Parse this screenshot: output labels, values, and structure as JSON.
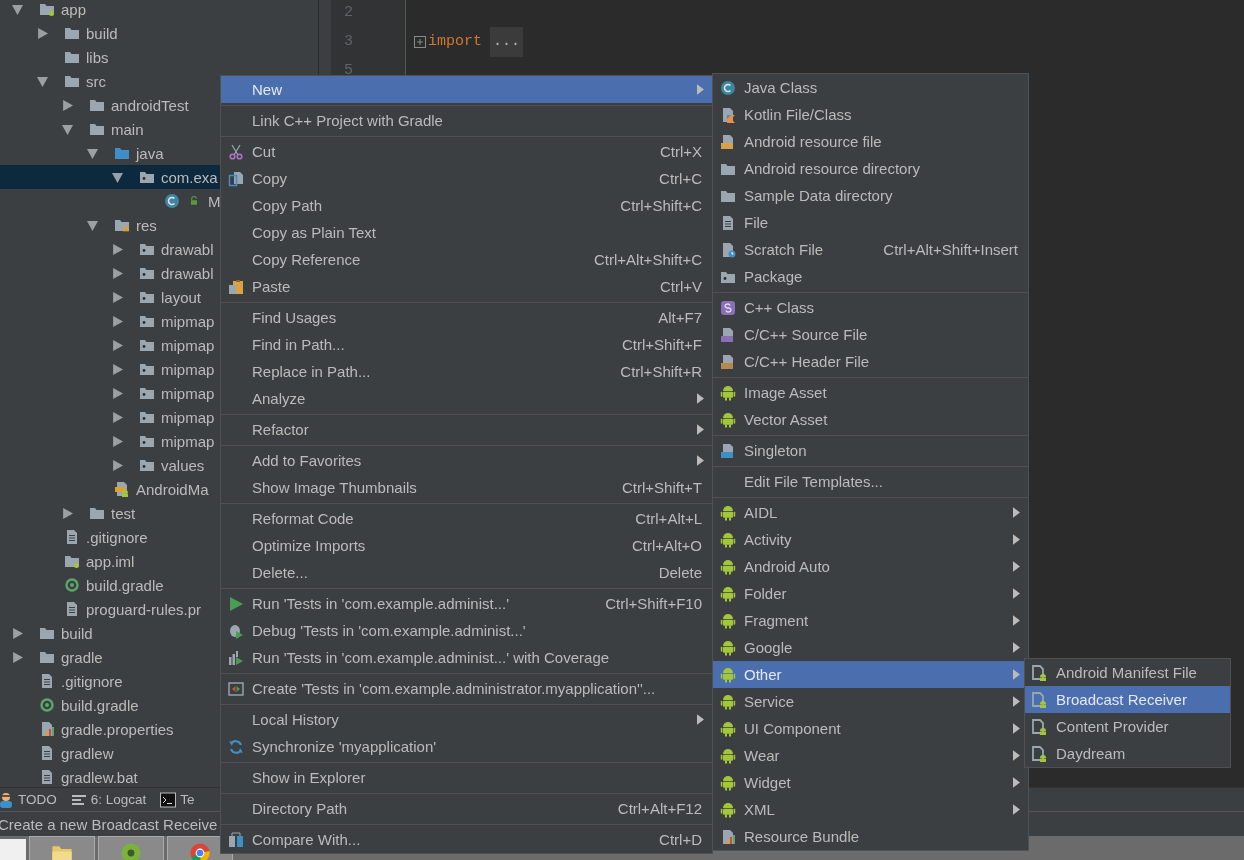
{
  "tree": [
    {
      "label": "app",
      "kind": "module",
      "expanded": true,
      "selected": false,
      "children": [
        {
          "label": "build",
          "kind": "folder",
          "expanded": false,
          "selected": false
        },
        {
          "label": "libs",
          "kind": "folder",
          "selected": false
        },
        {
          "label": "src",
          "kind": "folder",
          "expanded": true,
          "selected": false,
          "children": [
            {
              "label": "androidTest",
              "kind": "folder",
              "expanded": false,
              "selected": false
            },
            {
              "label": "main",
              "kind": "folder",
              "expanded": true,
              "selected": false,
              "children": [
                {
                  "label": "java",
                  "kind": "source-folder",
                  "expanded": true,
                  "selected": false,
                  "children": [
                    {
                      "label": "com.exa",
                      "kind": "package",
                      "expanded": true,
                      "selected": true,
                      "children": [
                        {
                          "label": "M",
                          "kind": "class",
                          "locked": true,
                          "selected": false
                        }
                      ]
                    }
                  ]
                },
                {
                  "label": "res",
                  "kind": "res-folder",
                  "expanded": true,
                  "selected": false,
                  "children": [
                    {
                      "label": "drawabl",
                      "kind": "package",
                      "expanded": false,
                      "selected": false
                    },
                    {
                      "label": "drawabl",
                      "kind": "package",
                      "expanded": false,
                      "selected": false
                    },
                    {
                      "label": "layout",
                      "kind": "package",
                      "expanded": false,
                      "selected": false
                    },
                    {
                      "label": "mipmap",
                      "kind": "package",
                      "expanded": false,
                      "selected": false
                    },
                    {
                      "label": "mipmap",
                      "kind": "package",
                      "expanded": false,
                      "selected": false
                    },
                    {
                      "label": "mipmap",
                      "kind": "package",
                      "expanded": false,
                      "selected": false
                    },
                    {
                      "label": "mipmap",
                      "kind": "package",
                      "expanded": false,
                      "selected": false
                    },
                    {
                      "label": "mipmap",
                      "kind": "package",
                      "expanded": false,
                      "selected": false
                    },
                    {
                      "label": "mipmap",
                      "kind": "package",
                      "expanded": false,
                      "selected": false
                    },
                    {
                      "label": "values",
                      "kind": "package",
                      "expanded": false,
                      "selected": false
                    }
                  ]
                },
                {
                  "label": "AndroidMa",
                  "kind": "manifest",
                  "selected": false
                }
              ]
            },
            {
              "label": "test",
              "kind": "folder",
              "expanded": false,
              "selected": false
            }
          ]
        },
        {
          "label": ".gitignore",
          "kind": "file",
          "selected": false
        },
        {
          "label": "app.iml",
          "kind": "module",
          "selected": false
        },
        {
          "label": "build.gradle",
          "kind": "gradle",
          "selected": false
        },
        {
          "label": "proguard-rules.pr",
          "kind": "file",
          "selected": false
        }
      ]
    },
    {
      "label": "build",
      "kind": "folder",
      "expanded": false,
      "selected": false
    },
    {
      "label": "gradle",
      "kind": "folder",
      "expanded": false,
      "selected": false
    },
    {
      "label": ".gitignore",
      "kind": "file",
      "selected": false
    },
    {
      "label": "build.gradle",
      "kind": "gradle",
      "selected": false
    },
    {
      "label": "gradle.properties",
      "kind": "props",
      "selected": false
    },
    {
      "label": "gradlew",
      "kind": "file",
      "selected": false
    },
    {
      "label": "gradlew.bat",
      "kind": "file",
      "selected": false
    }
  ],
  "editor": {
    "lines": [
      {
        "number": "2"
      },
      {
        "number": "3",
        "code": "import",
        "folded": "..."
      },
      {
        "number": "5"
      }
    ]
  },
  "tool_tabs": [
    {
      "label": "TODO",
      "kind": "person"
    },
    {
      "label": "6: Logcat",
      "kind": "logcat"
    },
    {
      "label": "Te",
      "kind": "terminal"
    }
  ],
  "status_bar": "Create a new Broadcast Receive",
  "taskbar": [
    {
      "kind": "folder-app"
    },
    {
      "kind": "studio-app"
    },
    {
      "kind": "browser-app"
    }
  ],
  "context_menu": {
    "groups": [
      [
        {
          "label": "New",
          "submenu": true,
          "selected": true
        }
      ],
      [
        {
          "label": "Link C++ Project with Gradle",
          "selected": false
        }
      ],
      [
        {
          "label": "Cut",
          "shortcut": "Ctrl+X",
          "kind": "scissors",
          "selected": false
        },
        {
          "label": "Copy",
          "shortcut": "Ctrl+C",
          "kind": "copy",
          "selected": false
        },
        {
          "label": "Copy Path",
          "shortcut": "Ctrl+Shift+C",
          "selected": false
        },
        {
          "label": "Copy as Plain Text",
          "selected": false
        },
        {
          "label": "Copy Reference",
          "shortcut": "Ctrl+Alt+Shift+C",
          "selected": false
        },
        {
          "label": "Paste",
          "shortcut": "Ctrl+V",
          "kind": "paste",
          "selected": false
        }
      ],
      [
        {
          "label": "Find Usages",
          "shortcut": "Alt+F7",
          "selected": false
        },
        {
          "label": "Find in Path...",
          "shortcut": "Ctrl+Shift+F",
          "selected": false
        },
        {
          "label": "Replace in Path...",
          "shortcut": "Ctrl+Shift+R",
          "selected": false
        },
        {
          "label": "Analyze",
          "submenu": true,
          "selected": false
        }
      ],
      [
        {
          "label": "Refactor",
          "submenu": true,
          "selected": false
        }
      ],
      [
        {
          "label": "Add to Favorites",
          "submenu": true,
          "selected": false
        },
        {
          "label": "Show Image Thumbnails",
          "shortcut": "Ctrl+Shift+T",
          "selected": false
        }
      ],
      [
        {
          "label": "Reformat Code",
          "shortcut": "Ctrl+Alt+L",
          "selected": false
        },
        {
          "label": "Optimize Imports",
          "shortcut": "Ctrl+Alt+O",
          "selected": false
        },
        {
          "label": "Delete...",
          "shortcut": "Delete",
          "selected": false
        }
      ],
      [
        {
          "label": "Run 'Tests in 'com.example.administ...'",
          "shortcut": "Ctrl+Shift+F10",
          "kind": "run",
          "selected": false
        },
        {
          "label": "Debug 'Tests in 'com.example.administ...'",
          "kind": "debug",
          "selected": false
        },
        {
          "label": "Run 'Tests in 'com.example.administ...' with Coverage",
          "kind": "coverage",
          "selected": false
        }
      ],
      [
        {
          "label": "Create 'Tests in 'com.example.administrator.myapplication''...",
          "kind": "create-test",
          "selected": false
        }
      ],
      [
        {
          "label": "Local History",
          "submenu": true,
          "selected": false
        },
        {
          "label": "Synchronize 'myapplication'",
          "kind": "sync",
          "selected": false
        }
      ],
      [
        {
          "label": "Show in Explorer",
          "selected": false
        }
      ],
      [
        {
          "label": "Directory Path",
          "shortcut": "Ctrl+Alt+F12",
          "selected": false
        }
      ],
      [
        {
          "label": "Compare With...",
          "shortcut": "Ctrl+D",
          "kind": "compare",
          "selected": false
        }
      ]
    ]
  },
  "new_submenu": {
    "groups": [
      [
        {
          "label": "Java Class",
          "kind": "class",
          "selected": false
        },
        {
          "label": "Kotlin File/Class",
          "kind": "kotlin",
          "selected": false
        },
        {
          "label": "Android resource file",
          "kind": "res-file",
          "selected": false
        },
        {
          "label": "Android resource directory",
          "kind": "folder",
          "selected": false
        },
        {
          "label": "Sample Data directory",
          "kind": "folder",
          "selected": false
        },
        {
          "label": "File",
          "kind": "file",
          "selected": false
        },
        {
          "label": "Scratch File",
          "shortcut": "Ctrl+Alt+Shift+Insert",
          "kind": "scratch",
          "selected": false
        },
        {
          "label": "Package",
          "kind": "package",
          "selected": false
        }
      ],
      [
        {
          "label": "C++ Class",
          "kind": "cpp-class",
          "selected": false
        },
        {
          "label": "C/C++ Source File",
          "kind": "cpp-source",
          "selected": false
        },
        {
          "label": "C/C++ Header File",
          "kind": "cpp-header",
          "selected": false
        }
      ],
      [
        {
          "label": "Image Asset",
          "kind": "android",
          "selected": false
        },
        {
          "label": "Vector Asset",
          "kind": "android",
          "selected": false
        }
      ],
      [
        {
          "label": "Singleton",
          "kind": "singleton",
          "selected": false
        }
      ],
      [
        {
          "label": "Edit File Templates...",
          "selected": false
        }
      ],
      [
        {
          "label": "AIDL",
          "kind": "android",
          "submenu": true,
          "selected": false
        },
        {
          "label": "Activity",
          "kind": "android",
          "submenu": true,
          "selected": false
        },
        {
          "label": "Android Auto",
          "kind": "android",
          "submenu": true,
          "selected": false
        },
        {
          "label": "Folder",
          "kind": "android",
          "submenu": true,
          "selected": false
        },
        {
          "label": "Fragment",
          "kind": "android",
          "submenu": true,
          "selected": false
        },
        {
          "label": "Google",
          "kind": "android",
          "submenu": true,
          "selected": false
        },
        {
          "label": "Other",
          "kind": "android",
          "submenu": true,
          "selected": true
        },
        {
          "label": "Service",
          "kind": "android",
          "submenu": true,
          "selected": false
        },
        {
          "label": "UI Component",
          "kind": "android",
          "submenu": true,
          "selected": false
        },
        {
          "label": "Wear",
          "kind": "android",
          "submenu": true,
          "selected": false
        },
        {
          "label": "Widget",
          "kind": "android",
          "submenu": true,
          "selected": false
        },
        {
          "label": "XML",
          "kind": "android",
          "submenu": true,
          "selected": false
        },
        {
          "label": "Resource Bundle",
          "kind": "bundle",
          "selected": false
        }
      ]
    ]
  },
  "other_submenu": {
    "groups": [
      [
        {
          "label": "Android Manifest File",
          "kind": "android-file",
          "selected": false
        },
        {
          "label": "Broadcast Receiver",
          "kind": "android-file",
          "selected": true
        },
        {
          "label": "Content Provider",
          "kind": "android-file",
          "selected": false
        },
        {
          "label": "Daydream",
          "kind": "android-file",
          "selected": false
        }
      ]
    ]
  }
}
